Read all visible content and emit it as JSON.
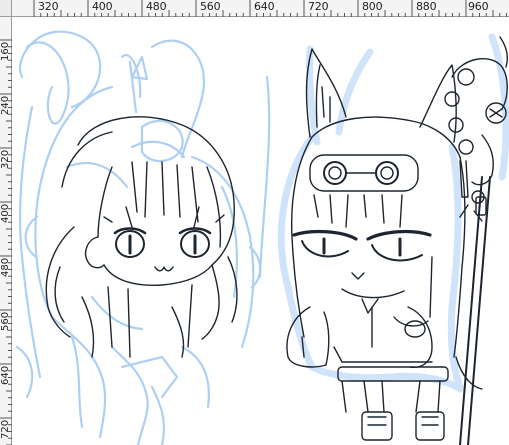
{
  "ruler": {
    "top_labels": [
      "320",
      "400",
      "480",
      "560",
      "640",
      "720",
      "800",
      "880",
      "960"
    ],
    "left_labels": [
      "160",
      "240",
      "320",
      "400",
      "480",
      "560",
      "640",
      "720"
    ]
  },
  "canvas": {
    "layers": [
      "sketch-layer",
      "character-left-lineart",
      "character-right-lineart"
    ]
  },
  "colors": {
    "sketch_blue": "#a9cdf2",
    "glow_blue": "#cfe4fa",
    "line_dark": "#1d2530",
    "ruler_bg": "#f4f4f4"
  },
  "icons": [
    "ruler-tick-icon"
  ]
}
